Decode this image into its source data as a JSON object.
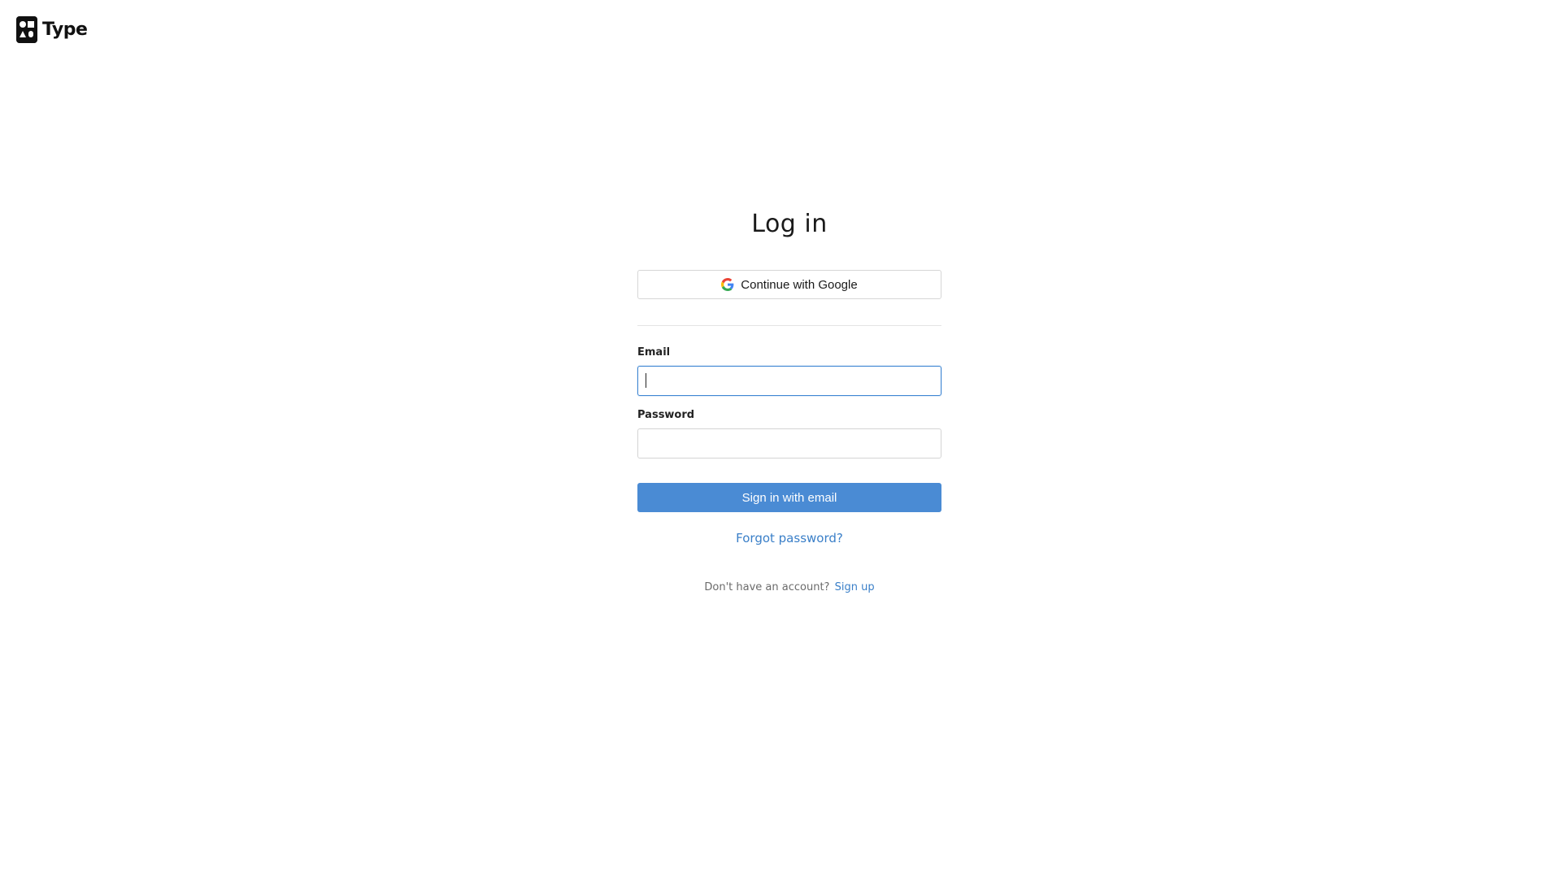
{
  "brand": {
    "name": "Type",
    "logo_icon": "type-logo-icon"
  },
  "login": {
    "title": "Log in",
    "google_button_label": "Continue with Google",
    "google_icon": "google-icon",
    "email_label": "Email",
    "email_value": "",
    "password_label": "Password",
    "password_value": "",
    "submit_label": "Sign in with email",
    "forgot_label": "Forgot password?",
    "signup_prompt": "Don't have an account?",
    "signup_link_label": "Sign up"
  },
  "colors": {
    "primary": "#4a8bd4",
    "link": "#3a7fc8",
    "focus_border": "#3f86d3"
  }
}
